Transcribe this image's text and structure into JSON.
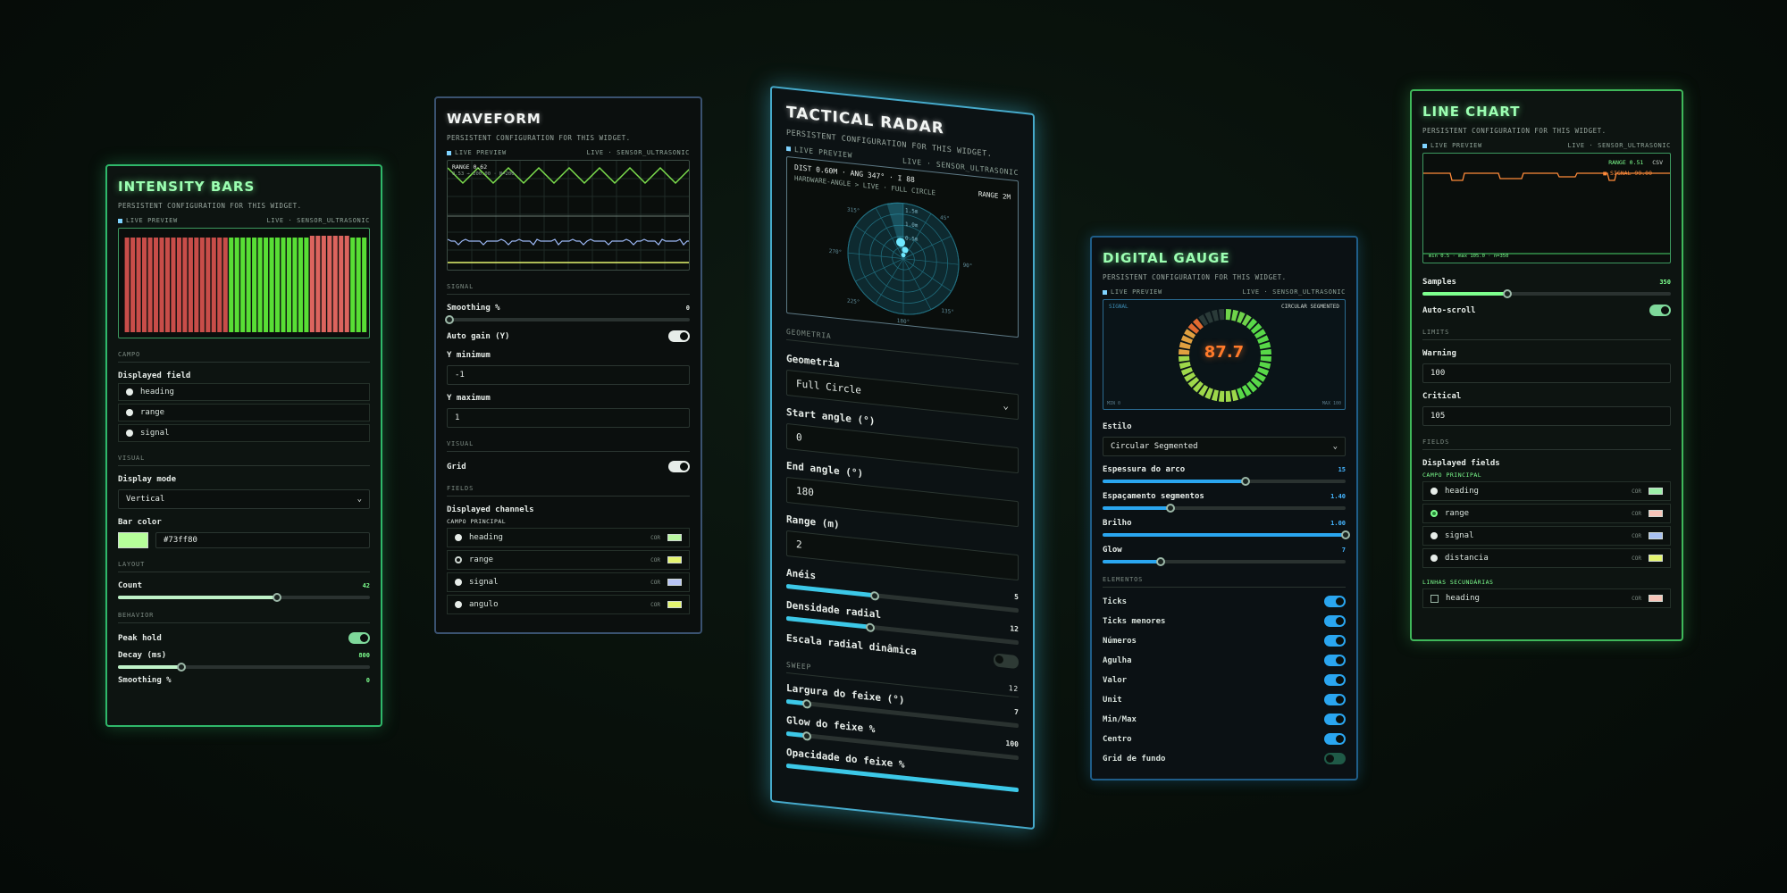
{
  "intensity": {
    "title": "INTENSITY BARS",
    "subtitle": "PERSISTENT CONFIGURATION FOR THIS WIDGET.",
    "live": "LIVE PREVIEW",
    "sensor": "LIVE · SENSOR_ULTRASONIC",
    "campo_section": "CAMPO",
    "displayed_field_label": "Displayed field",
    "fields": [
      "heading",
      "range",
      "signal"
    ],
    "visual_section": "VISUAL",
    "display_mode_label": "Display mode",
    "display_mode": "Vertical",
    "bar_color_label": "Bar color",
    "bar_color": "#73ff80",
    "layout_section": "LAYOUT",
    "count_label": "Count",
    "count": "42",
    "count_fraction": 0.63,
    "behavior_section": "BEHAVIOR",
    "peak_hold_label": "Peak hold",
    "decay_label": "Decay (ms)",
    "decay": "800",
    "decay_fraction": 0.25,
    "smoothing_label": "Smoothing %",
    "smoothing": "0"
  },
  "waveform": {
    "title": "WAVEFORM",
    "subtitle": "PERSISTENT CONFIGURATION FOR THIS WIDGET.",
    "live": "LIVE PREVIEW",
    "sensor": "LIVE · SENSOR_ULTRASONIC",
    "range_readout": "RANGE 0.62",
    "range_sub": "0.53 → 200.00 · N=200",
    "signal_section": "SIGNAL",
    "smoothing_label": "Smoothing %",
    "smoothing": "0",
    "auto_gain_label": "Auto gain (Y)",
    "ymin_label": "Y minimum",
    "ymin": "-1",
    "ymax_label": "Y maximum",
    "ymax": "1",
    "visual_section": "VISUAL",
    "grid_label": "Grid",
    "fields_section": "FIELDS",
    "channels_label": "Displayed channels",
    "campo_principal": "CAMPO PRINCIPAL",
    "cor": "COR",
    "channels": [
      {
        "name": "heading",
        "color": "#b9f7a0"
      },
      {
        "name": "range",
        "color": "#e4f56f"
      },
      {
        "name": "signal",
        "color": "#b8c4f5"
      },
      {
        "name": "angulo",
        "color": "#e4f56f"
      }
    ]
  },
  "radar": {
    "title": "TACTICAL RADAR",
    "subtitle": "PERSISTENT CONFIGURATION FOR THIS WIDGET.",
    "live": "LIVE PREVIEW",
    "sensor": "LIVE · SENSOR_ULTRASONIC",
    "readout": "DIST 0.60M · ANG 347° · I 88",
    "mode": "HARDWARE-ANGLE > LIVE · FULL CIRCLE",
    "range_tag": "RANGE 2M",
    "ring_labels": [
      "1.5m",
      "1.0m",
      "0.5m"
    ],
    "angle_labels": [
      "0°",
      "90°",
      "180°",
      "270°",
      "45°",
      "135°",
      "225°",
      "315°"
    ],
    "geometria_section": "GEOMETRIA",
    "geometria_label": "Geometria",
    "geometria": "Full Circle",
    "start_label": "Start angle (°)",
    "start": "0",
    "end_label": "End angle (°)",
    "end": "180",
    "range_label": "Range (m)",
    "range": "2",
    "aneis_label": "Anéis",
    "aneis": "5",
    "aneis_fraction": 0.38,
    "densidade_label": "Densidade radial",
    "densidade": "12",
    "densidade_fraction": 0.36,
    "escala_label": "Escala radial dinâmica",
    "sweep_section": "SWEEP",
    "sweep_top": "12",
    "largura_label": "Largura do feixe (°)",
    "largura": "7",
    "largura_fraction": 0.09,
    "glow_label": "Glow do feixe %",
    "glow": "100",
    "glow_fraction": 0.09,
    "opacidade_label": "Opacidade do feixe %"
  },
  "gauge": {
    "title": "DIGITAL GAUGE",
    "subtitle": "PERSISTENT CONFIGURATION FOR THIS WIDGET.",
    "live": "LIVE PREVIEW",
    "sensor": "LIVE · SENSOR_ULTRASONIC",
    "signal_tag": "SIGNAL",
    "style_tag": "CIRCULAR SEGMENTED",
    "value": "87.7",
    "min_tag": "MIN 0",
    "max_tag": "MAX 100",
    "value_fraction": 0.877,
    "estilo_label": "Estilo",
    "estilo": "Circular Segmented",
    "espessura_label": "Espessura do arco",
    "espessura": "15",
    "espessura_fraction": 0.59,
    "espacamento_label": "Espaçamento segmentos",
    "espacamento": "1.40",
    "espacamento_fraction": 0.28,
    "brilho_label": "Brilho",
    "brilho": "1.00",
    "brilho_fraction": 1.0,
    "glow_label": "Glow",
    "glow": "7",
    "glow_fraction": 0.24,
    "elementos_section": "ELEMENTOS",
    "elements": [
      "Ticks",
      "Ticks menores",
      "Números",
      "Agulha",
      "Valor",
      "Unit",
      "Min/Max",
      "Centro",
      "Grid de fundo"
    ]
  },
  "line": {
    "title": "LINE CHART",
    "subtitle": "PERSISTENT CONFIGURATION FOR THIS WIDGET.",
    "live": "LIVE PREVIEW",
    "sensor": "LIVE · SENSOR_ULTRASONIC",
    "range_tag": "RANGE 0.51",
    "csv": "CSV",
    "signal_tag": "SIGNAL 99.00",
    "stats": "min 0.5 · max 105.0 · n=350",
    "samples_label": "Samples",
    "samples": "350",
    "samples_fraction": 0.34,
    "autoscroll_label": "Auto-scroll",
    "limits_section": "LIMITS",
    "warning_label": "Warning",
    "warning": "100",
    "critical_label": "Critical",
    "critical": "105",
    "fields_section": "FIELDS",
    "displayed_label": "Displayed fields",
    "campo_principal": "CAMPO PRINCIPAL",
    "cor": "COR",
    "fields": [
      {
        "name": "heading",
        "color": "#9cf0a8"
      },
      {
        "name": "range",
        "color": "#f7c4b8"
      },
      {
        "name": "signal",
        "color": "#a8c0f0"
      },
      {
        "name": "distancia",
        "color": "#e4f56f"
      }
    ],
    "linhas_section": "LINHAS SECUNDÁRIAS",
    "secondary": {
      "name": "heading",
      "color": "#f7c4b8"
    }
  },
  "colors": {
    "green_accent": "#7dff8e",
    "blue_accent": "#2aa6f0",
    "cyan_accent": "#3cc8e8",
    "bar_red": "#d9534f",
    "bar_green": "#5ff03a"
  }
}
